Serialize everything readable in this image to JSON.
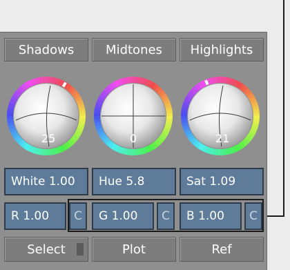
{
  "tabs": [
    {
      "label": "Shadows"
    },
    {
      "label": "Midtones"
    },
    {
      "label": "Highlights"
    }
  ],
  "wheels": [
    {
      "value": "25"
    },
    {
      "value": "0"
    },
    {
      "value": "21"
    }
  ],
  "fields": {
    "white": "White 1.00",
    "hue": "Hue 5.8",
    "sat": "Sat 1.09",
    "r": "R 1.00",
    "g": "G 1.00",
    "b": "B 1.00",
    "c": "C"
  },
  "bottom": {
    "select": "Select",
    "plot": "Plot",
    "ref": "Ref"
  },
  "colors": {
    "field_bg": "#5e7b99",
    "panel_bg": "#8f8f8f"
  }
}
